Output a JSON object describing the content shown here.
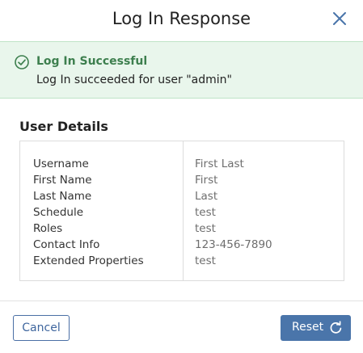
{
  "dialog": {
    "title": "Log In Response",
    "close_icon": "close-icon"
  },
  "alert": {
    "icon": "check-circle-icon",
    "title": "Log In Successful",
    "message": "Log In succeeded for user \"admin\"",
    "colors": {
      "background": "#e9f6ec",
      "title": "#3d7f4e"
    }
  },
  "user_details": {
    "heading": "User Details",
    "rows": [
      {
        "label": "Username",
        "value": "First Last"
      },
      {
        "label": "First Name",
        "value": "First"
      },
      {
        "label": "Last Name",
        "value": "Last"
      },
      {
        "label": "Schedule",
        "value": "test"
      },
      {
        "label": "Roles",
        "value": "test"
      },
      {
        "label": "Contact Info",
        "value": "123-456-7890"
      },
      {
        "label": "Extended Properties",
        "value": "test"
      }
    ]
  },
  "footer": {
    "cancel_label": "Cancel",
    "reset_label": "Reset",
    "reset_icon": "refresh-icon",
    "colors": {
      "primary": "#4a75aa"
    }
  }
}
